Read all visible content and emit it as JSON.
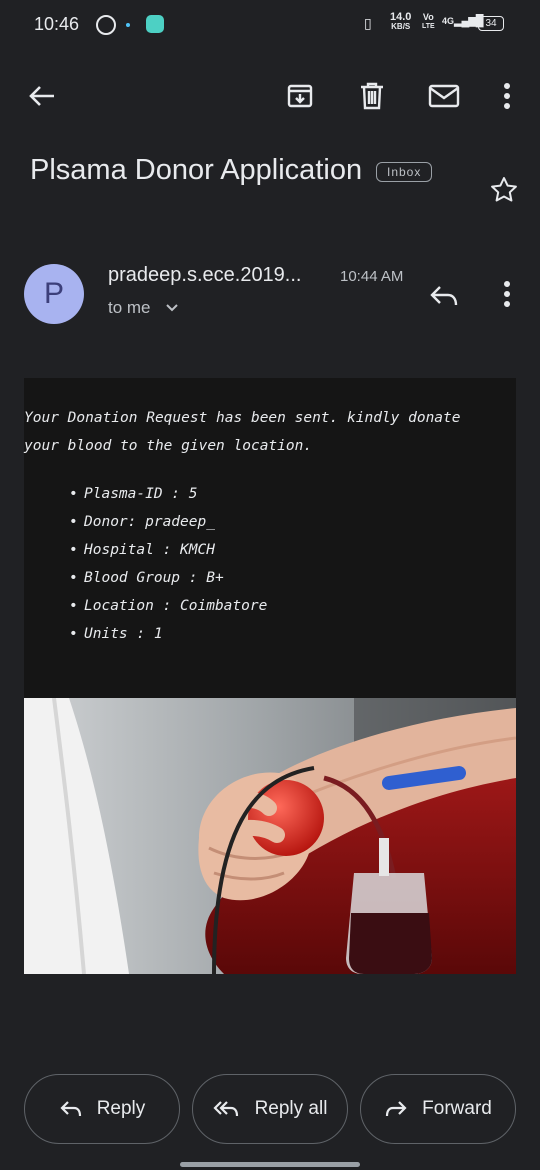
{
  "status_bar": {
    "time": "10:46",
    "speed_value": "14.0",
    "speed_unit": "KB/S",
    "volte_top": "Vo",
    "volte_bottom": "LTE",
    "network": "4G",
    "battery": "34"
  },
  "toolbar": {
    "back_icon": "arrow-left-icon",
    "archive_icon": "archive-icon",
    "delete_icon": "trash-icon",
    "unread_icon": "mail-icon",
    "more_icon": "more-vert-icon"
  },
  "email": {
    "subject": "Plsama Donor Application",
    "label": "Inbox",
    "sender_initial": "P",
    "sender": "pradeep.s.ece.2019...",
    "time": "10:44 AM",
    "recipient": "to me",
    "body": {
      "intro": "Your Donation Request has been sent. kindly donate your blood to the given location.",
      "details": [
        "Plasma-ID : 5",
        "Donor: pradeep_",
        "Hospital : KMCH",
        "Blood Group : B+",
        "Location : Coimbatore",
        "Units : 1"
      ]
    }
  },
  "actions": {
    "reply": "Reply",
    "reply_all": "Reply all",
    "forward": "Forward"
  },
  "colors": {
    "background": "#202124",
    "card": "#151515",
    "avatar": "#a8b3f0"
  }
}
